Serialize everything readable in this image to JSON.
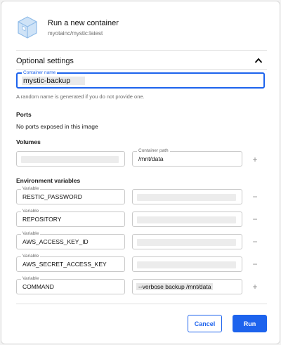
{
  "header": {
    "title": "Run a new container",
    "image": "myotainc/mystic:latest",
    "icon": "container-icon"
  },
  "optional": {
    "title": "Optional settings",
    "toggle_icon": "chevron-up-icon",
    "container_name": {
      "label": "Container name",
      "value": "mystic-backup"
    },
    "helper": "A random name is generated if you do not provide one."
  },
  "ports": {
    "title": "Ports",
    "message": "No ports exposed in this image"
  },
  "volumes": {
    "title": "Volumes",
    "host_path_value": "",
    "container_path_label": "Container path",
    "container_path_value": "/mnt/data",
    "add_icon": "plus-icon"
  },
  "env": {
    "title": "Environment variables",
    "variable_label": "Variable",
    "rows": [
      {
        "name": "RESTIC_PASSWORD",
        "value": "",
        "action": "minus-icon"
      },
      {
        "name": "REPOSITORY",
        "value": "",
        "action": "minus-icon"
      },
      {
        "name": "AWS_ACCESS_KEY_ID",
        "value": "",
        "action": "minus-icon"
      },
      {
        "name": "AWS_SECRET_ACCESS_KEY",
        "value": "",
        "action": "minus-icon"
      },
      {
        "name": "COMMAND",
        "value": "--verbose backup /mnt/data",
        "action": "plus-icon"
      }
    ]
  },
  "footer": {
    "cancel_label": "Cancel",
    "run_label": "Run"
  },
  "colors": {
    "accent": "#1d63ed",
    "border": "#c9c9c9",
    "muted_text": "#6b6b6b"
  }
}
